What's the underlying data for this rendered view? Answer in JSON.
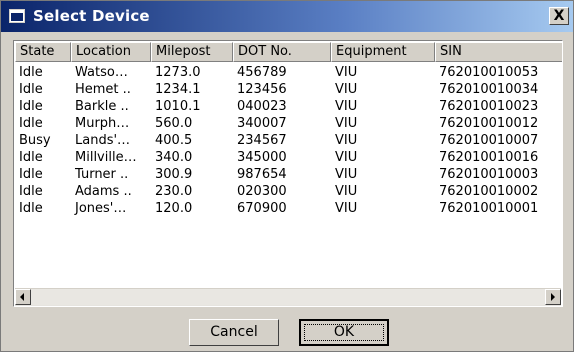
{
  "window": {
    "title": "Select Device",
    "close_glyph": "X"
  },
  "table": {
    "columns": [
      "State",
      "Location",
      "Milepost",
      "DOT No.",
      "Equipment",
      "SIN"
    ],
    "rows": [
      [
        "Idle",
        "Watso…",
        "1273.0",
        "456789",
        "VIU",
        "762010010053"
      ],
      [
        "Idle",
        "Hemet ..",
        "1234.1",
        "123456",
        "VIU",
        "762010010034"
      ],
      [
        "Idle",
        "Barkle ..",
        "1010.1",
        "040023",
        "VIU",
        "762010010023"
      ],
      [
        "Idle",
        "Murph…",
        "560.0",
        "340007",
        "VIU",
        "762010010012"
      ],
      [
        "Busy",
        "Lands'…",
        "400.5",
        "234567",
        "VIU",
        "762010010007"
      ],
      [
        "Idle",
        "Millville…",
        "340.0",
        "345000",
        "VIU",
        "762010010016"
      ],
      [
        "Idle",
        "Turner ..",
        "300.9",
        "987654",
        "VIU",
        "762010010003"
      ],
      [
        "Idle",
        "Adams ..",
        "230.0",
        "020300",
        "VIU",
        "762010010002"
      ],
      [
        "Idle",
        "Jones'…",
        "120.0",
        "670900",
        "VIU",
        "762010010001"
      ]
    ]
  },
  "buttons": {
    "cancel": "Cancel",
    "ok": "OK"
  },
  "icons": {
    "title": "window-app-icon",
    "close": "close-icon",
    "scroll_left": "arrow-left-icon",
    "scroll_right": "arrow-right-icon"
  },
  "colors": {
    "title_bar_start": "#0a246a",
    "title_bar_end": "#a6caf0",
    "dialog_face": "#d4d0c8"
  }
}
